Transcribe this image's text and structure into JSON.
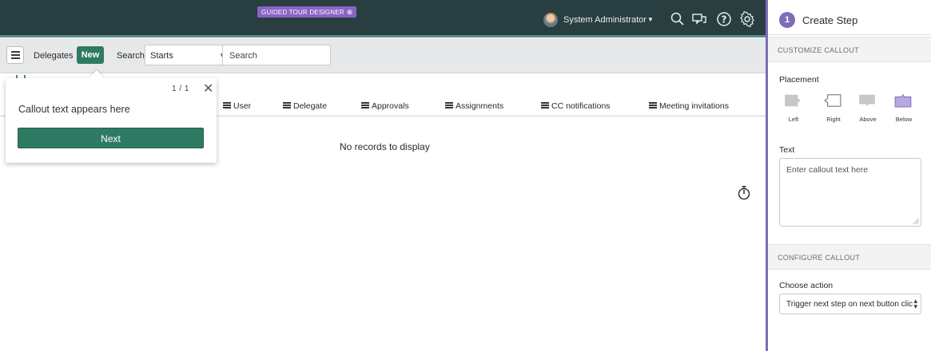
{
  "topbar": {
    "tour_badge": "GUIDED TOUR DESIGNER",
    "user_name": "System Administrator"
  },
  "list_header": {
    "title": "Delegates",
    "new_label": "New",
    "search_label": "Search",
    "search_field_value": "Starts",
    "search_placeholder": "Search"
  },
  "columns": [
    "User",
    "Delegate",
    "Approvals",
    "Assignments",
    "CC notifications",
    "Meeting invitations"
  ],
  "empty_message": "No records to display",
  "callout": {
    "counter": "1 / 1",
    "text": "Callout text appears here",
    "next_label": "Next"
  },
  "panel": {
    "step_number": "1",
    "title": "Create Step",
    "customize_section": "CUSTOMIZE CALLOUT",
    "placement_label": "Placement",
    "placement_options": [
      "Left",
      "Right",
      "Above",
      "Below"
    ],
    "text_label": "Text",
    "text_placeholder": "Enter callout text here",
    "configure_section": "CONFIGURE CALLOUT",
    "action_label": "Choose action",
    "action_value": "Trigger next step on next button click"
  },
  "colors": {
    "topbar": "#293e40",
    "primary_button": "#2f7a63",
    "designer_accent": "#7f6cb7",
    "selected_placement": "#b7a7e3"
  }
}
